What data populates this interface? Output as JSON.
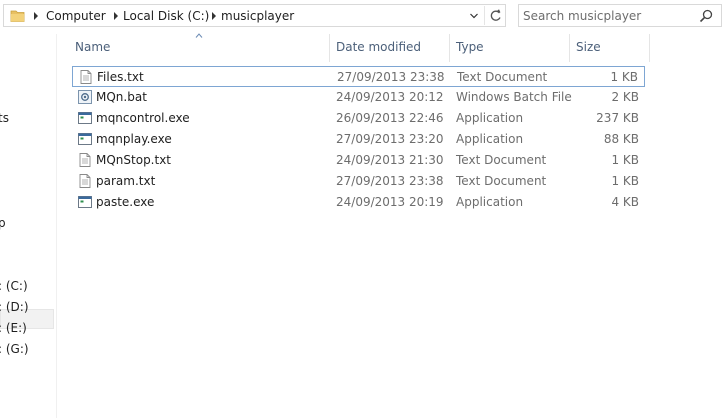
{
  "address": {
    "crumbs": [
      "Computer",
      "Local Disk (C:)",
      "musicplayer"
    ]
  },
  "search": {
    "placeholder": "Search musicplayer"
  },
  "nav": {
    "items": [
      "ts",
      "p",
      ": (C:)",
      ": (D:)",
      ": (E:)",
      ": (G:)"
    ]
  },
  "columns": {
    "name": "Name",
    "date": "Date modified",
    "type": "Type",
    "size": "Size"
  },
  "files": [
    {
      "name": "Files.txt",
      "date": "27/09/2013 23:38",
      "type": "Text Document",
      "size": "1 KB",
      "icon": "text-file-icon"
    },
    {
      "name": "MQn.bat",
      "date": "24/09/2013 20:12",
      "type": "Windows Batch File",
      "size": "2 KB",
      "icon": "batch-file-icon"
    },
    {
      "name": "mqncontrol.exe",
      "date": "26/09/2013 22:46",
      "type": "Application",
      "size": "237 KB",
      "icon": "application-icon"
    },
    {
      "name": "mqnplay.exe",
      "date": "27/09/2013 23:20",
      "type": "Application",
      "size": "88 KB",
      "icon": "application-icon"
    },
    {
      "name": "MQnStop.txt",
      "date": "24/09/2013 21:30",
      "type": "Text Document",
      "size": "1 KB",
      "icon": "text-file-icon"
    },
    {
      "name": "param.txt",
      "date": "27/09/2013 23:38",
      "type": "Text Document",
      "size": "1 KB",
      "icon": "text-file-icon"
    },
    {
      "name": "paste.exe",
      "date": "24/09/2013 20:19",
      "type": "Application",
      "size": "4 KB",
      "icon": "application-icon"
    }
  ],
  "colors": {
    "header_text": "#4c607a",
    "selection_border": "#7ea6d3",
    "folder": "#e8c063"
  }
}
